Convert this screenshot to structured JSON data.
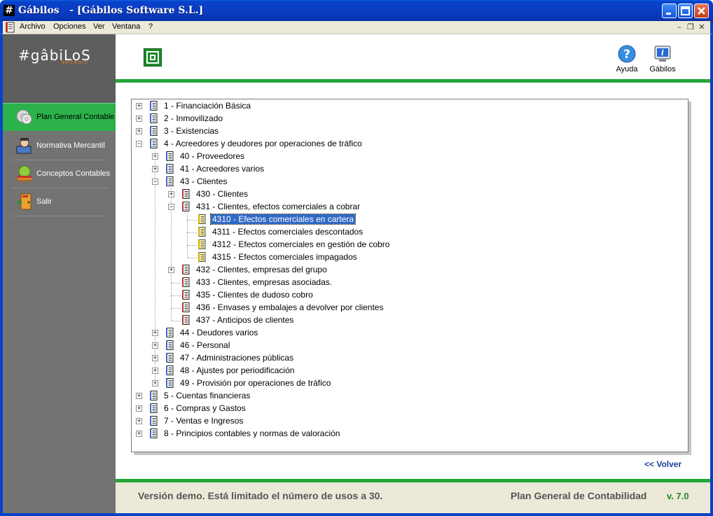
{
  "window": {
    "title": "Gábilos   - [Gábilos Software S.L.]",
    "app_icon": "#"
  },
  "menu": {
    "items": [
      "Archivo",
      "Opciones",
      "Ver",
      "Ventana",
      "?"
    ]
  },
  "logo": {
    "name": "#gâbiLoS",
    "sub": "software"
  },
  "sidebar": {
    "items": [
      {
        "label": "Plan General Contable",
        "icon": "cd-icon",
        "active": true
      },
      {
        "label": "Normativa Mercantil",
        "icon": "person-icon",
        "active": false
      },
      {
        "label": "Conceptos Contables",
        "icon": "books-icon",
        "active": false
      },
      {
        "label": "Salir",
        "icon": "exit-door-icon",
        "active": false
      }
    ]
  },
  "toolbar": {
    "help_label": "Ayuda",
    "about_label": "Gábilos"
  },
  "tree": {
    "nodes": [
      {
        "level": 0,
        "label": "1 - Financiación Básica",
        "exp": "+",
        "icon": "blue"
      },
      {
        "level": 0,
        "label": "2 - Inmovilizado",
        "exp": "+",
        "icon": "blue"
      },
      {
        "level": 0,
        "label": "3 - Existencias",
        "exp": "+",
        "icon": "blue"
      },
      {
        "level": 0,
        "label": "4 - Acreedores y deudores por operaciones de tráfico",
        "exp": "-",
        "icon": "blue"
      },
      {
        "level": 1,
        "label": "40 - Proveedores",
        "exp": "+",
        "icon": "blue"
      },
      {
        "level": 1,
        "label": "41 - Acreedores varios",
        "exp": "+",
        "icon": "blue"
      },
      {
        "level": 1,
        "label": "43 - Clientes",
        "exp": "-",
        "icon": "blue"
      },
      {
        "level": 2,
        "label": "430 - Clientes",
        "exp": "+",
        "icon": "red"
      },
      {
        "level": 2,
        "label": "431 - Clientes, efectos comerciales a cobrar",
        "exp": "-",
        "icon": "red"
      },
      {
        "level": 3,
        "label": "4310 - Efectos comerciales en cartera",
        "exp": "",
        "icon": "yellow",
        "selected": true
      },
      {
        "level": 3,
        "label": "4311 - Efectos comerciales descontados",
        "exp": "",
        "icon": "yellow"
      },
      {
        "level": 3,
        "label": "4312 - Efectos comerciales en gestión de cobro",
        "exp": "",
        "icon": "yellow"
      },
      {
        "level": 3,
        "label": "4315 - Efectos comerciales impagados",
        "exp": "",
        "icon": "yellow"
      },
      {
        "level": 2,
        "label": "432 - Clientes, empresas del grupo",
        "exp": "+",
        "icon": "red"
      },
      {
        "level": 2,
        "label": "433 - Clientes, empresas asociadas.",
        "exp": "",
        "icon": "red"
      },
      {
        "level": 2,
        "label": "435 - Clientes de dudoso cobro",
        "exp": "",
        "icon": "red"
      },
      {
        "level": 2,
        "label": "436 - Envases y embalajes a devolver por clientes",
        "exp": "",
        "icon": "red"
      },
      {
        "level": 2,
        "label": "437 - Anticipos de clientes",
        "exp": "",
        "icon": "red"
      },
      {
        "level": 1,
        "label": "44 - Deudores varios",
        "exp": "+",
        "icon": "blue"
      },
      {
        "level": 1,
        "label": "46 - Personal",
        "exp": "+",
        "icon": "blue"
      },
      {
        "level": 1,
        "label": "47 - Administraciones públicas",
        "exp": "+",
        "icon": "blue"
      },
      {
        "level": 1,
        "label": "48 - Ajustes por periodificación",
        "exp": "+",
        "icon": "blue"
      },
      {
        "level": 1,
        "label": "49 - Provisión por operaciones de tráfico",
        "exp": "+",
        "icon": "blue"
      },
      {
        "level": 0,
        "label": "5 - Cuentas financieras",
        "exp": "+",
        "icon": "blue"
      },
      {
        "level": 0,
        "label": "6 - Compras y Gastos",
        "exp": "+",
        "icon": "blue"
      },
      {
        "level": 0,
        "label": "7 - Ventas e Ingresos",
        "exp": "+",
        "icon": "blue"
      },
      {
        "level": 0,
        "label": "8 - Principios contables y normas de valoración",
        "exp": "+",
        "icon": "blue"
      }
    ]
  },
  "volver_label": "<< Volver",
  "status": {
    "demo_text": "Versión demo. Está limitado el número de usos a 30.",
    "product_text": "Plan General de Contabilidad",
    "version_text": "v. 7.0"
  },
  "colors": {
    "accent_green": "#22a63a",
    "selection_blue": "#316ac5",
    "titlebar_blue": "#0842c8"
  }
}
